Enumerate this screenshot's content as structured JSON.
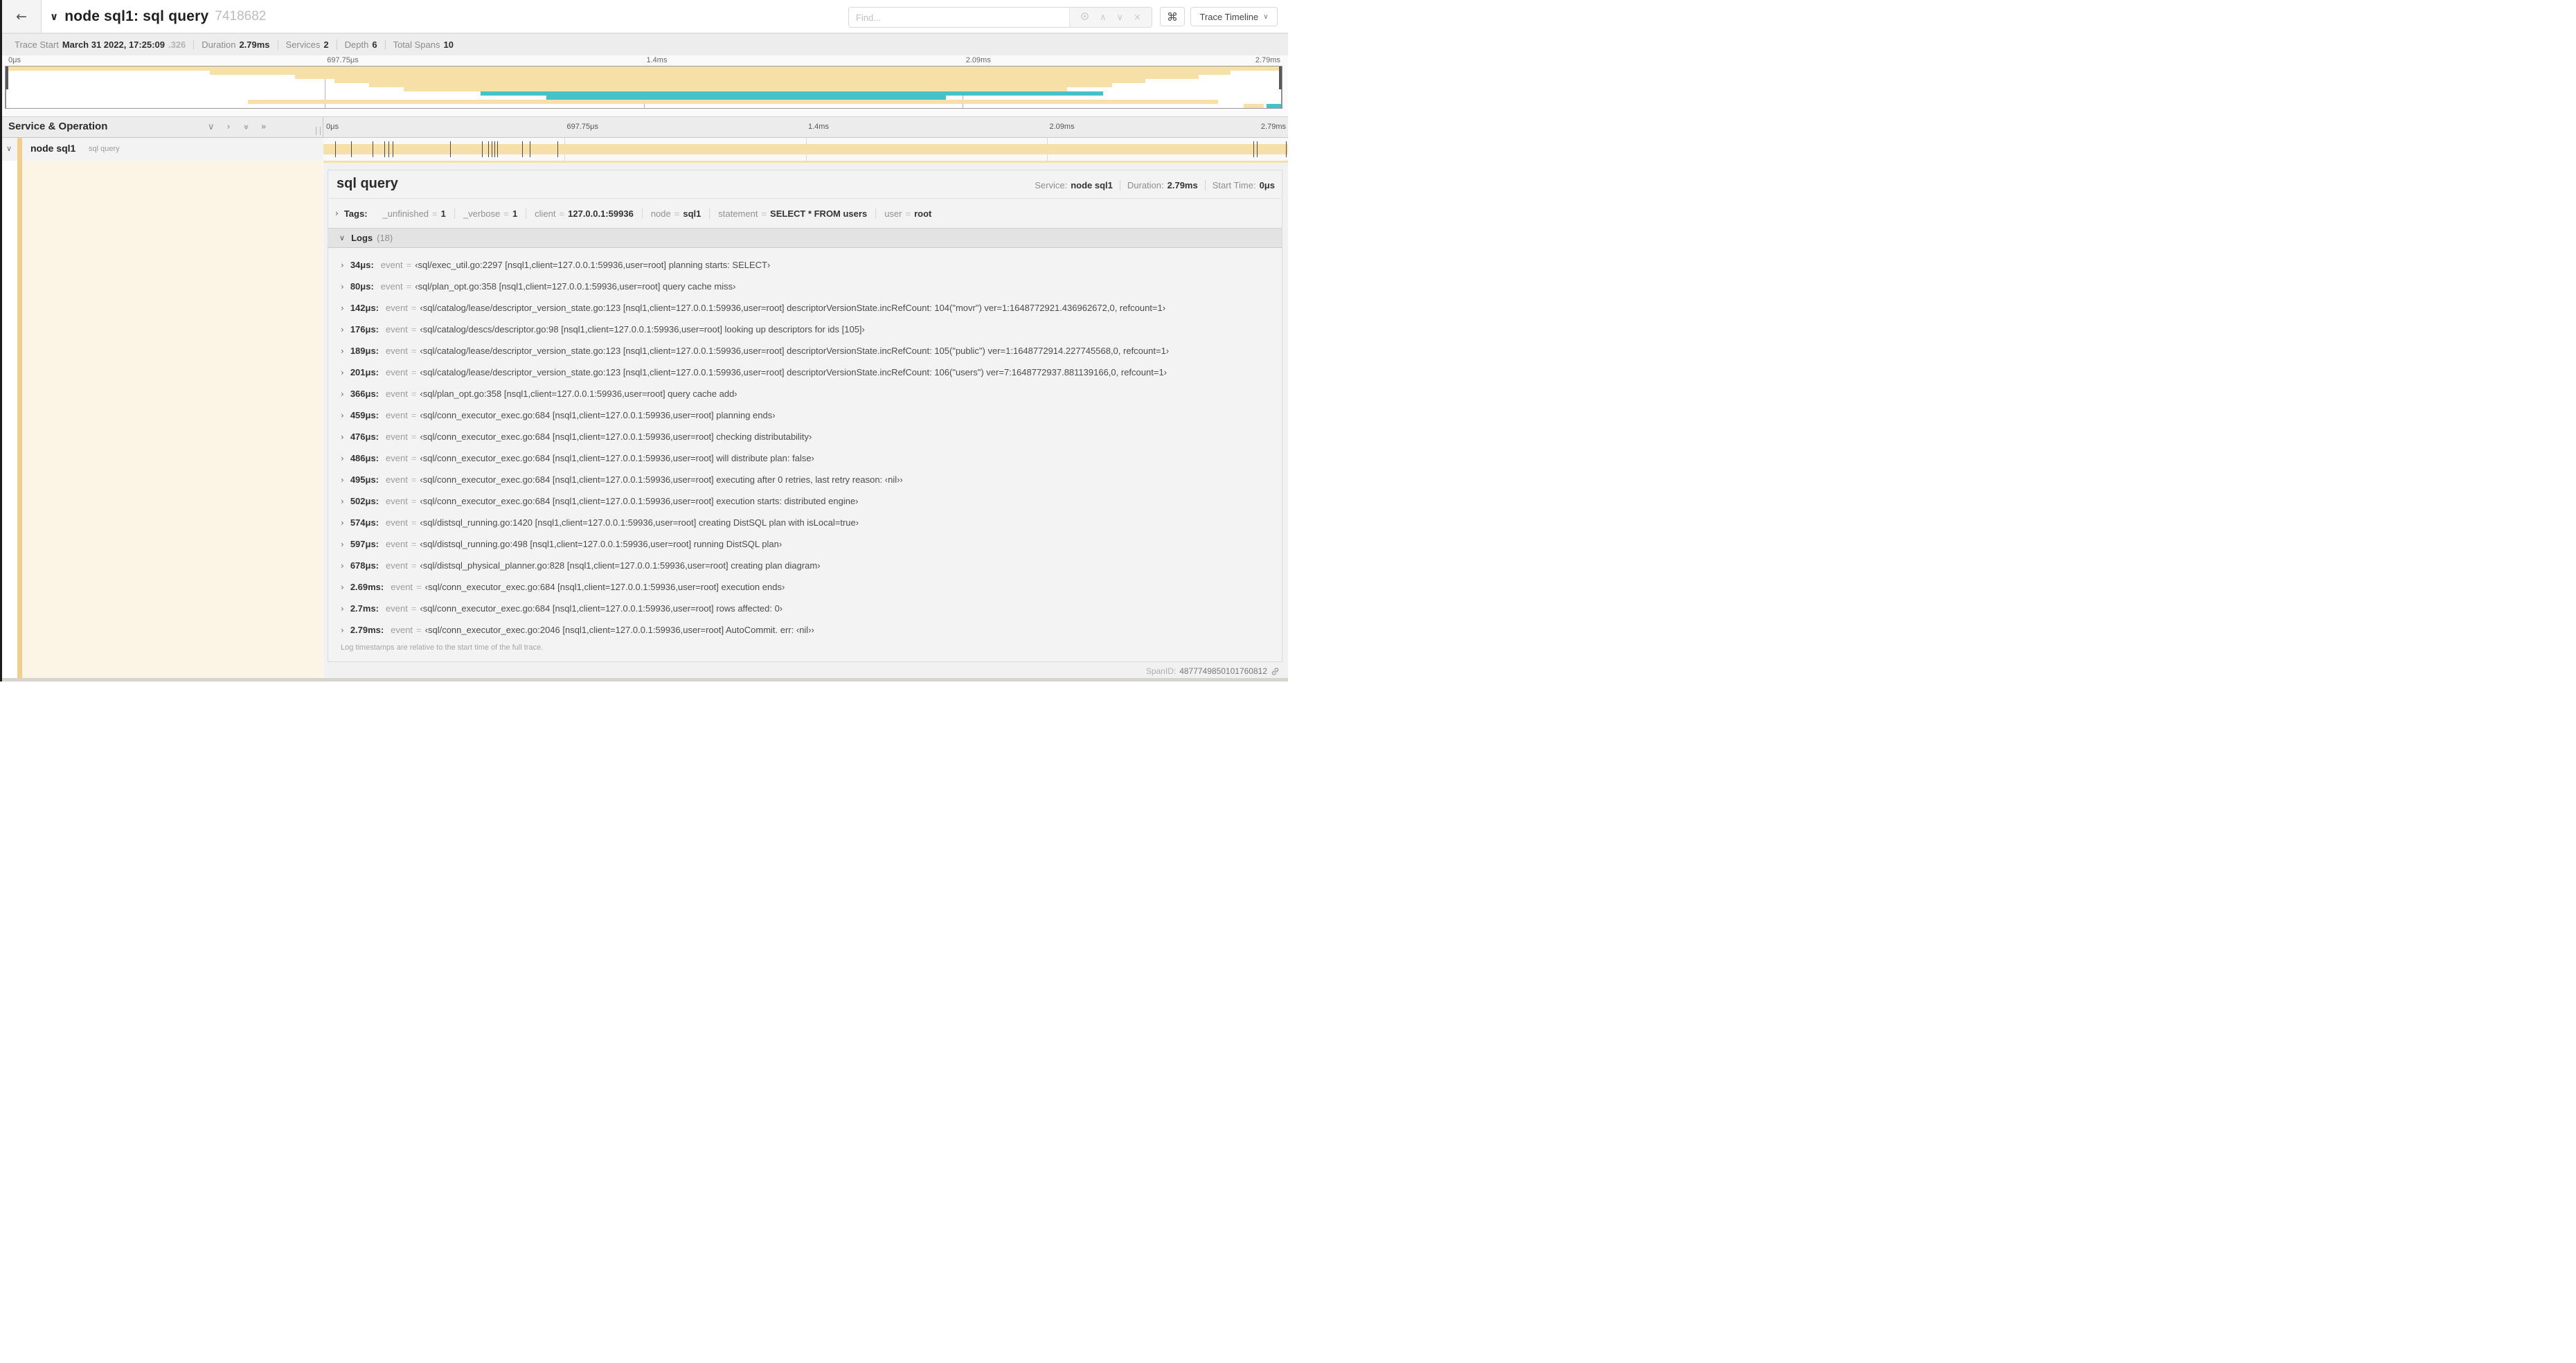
{
  "header": {
    "back_icon": "←",
    "collapse_caret": "∨",
    "title": "node sql1: sql query",
    "trace_id": "7418682",
    "find_placeholder": "Find...",
    "prev_icon": "∧",
    "next_icon": "∨",
    "clear_icon": "×",
    "shortcut_icon": "⌘",
    "view_selector": "Trace Timeline",
    "view_caret": "∨"
  },
  "summary": {
    "items": [
      {
        "label": "Trace Start",
        "value": "March 31 2022, 17:25:09",
        "suffix": ".326"
      },
      {
        "label": "Duration",
        "value": "2.79ms",
        "suffix": ""
      },
      {
        "label": "Services",
        "value": "2",
        "suffix": ""
      },
      {
        "label": "Depth",
        "value": "6",
        "suffix": ""
      },
      {
        "label": "Total Spans",
        "value": "10",
        "suffix": ""
      }
    ]
  },
  "colors": {
    "tan": "#f7dfa8",
    "teal": "#45c2c8",
    "accent_strip": "#f0cf8d",
    "cream": "#fcf5e6"
  },
  "minimap": {
    "ticks": [
      "0μs",
      "697.75μs",
      "1.4ms",
      "2.09ms",
      "2.79ms"
    ],
    "bars": [
      {
        "row": 0,
        "start": 0,
        "end": 100,
        "color": "tan"
      },
      {
        "row": 1,
        "start": 16,
        "end": 96,
        "color": "tan"
      },
      {
        "row": 2,
        "start": 22.7,
        "end": 93.5,
        "color": "tan"
      },
      {
        "row": 3,
        "start": 25.8,
        "end": 89.3,
        "color": "tan"
      },
      {
        "row": 4,
        "start": 28.5,
        "end": 86.7,
        "color": "tan"
      },
      {
        "row": 5,
        "start": 31.2,
        "end": 83.2,
        "color": "tan"
      },
      {
        "row": 6,
        "start": 37.2,
        "end": 86.0,
        "color": "teal"
      },
      {
        "row": 7,
        "start": 42.4,
        "end": 73.7,
        "color": "teal"
      },
      {
        "row": 8,
        "start": 19.0,
        "end": 95.0,
        "color": "tan"
      },
      {
        "row": 9,
        "start": 97.0,
        "end": 98.6,
        "color": "tan"
      },
      {
        "row": 9,
        "start": 98.8,
        "end": 100,
        "color": "teal"
      }
    ]
  },
  "timeline": {
    "left_header": "Service & Operation",
    "ticks": [
      "0μs",
      "697.75μs",
      "1.4ms",
      "2.09ms",
      "2.79ms"
    ],
    "row": {
      "service": "node sql1",
      "operation": "sql query"
    },
    "log_marker_positions": [
      1.22,
      2.87,
      5.09,
      6.31,
      6.77,
      7.2,
      13.12,
      16.45,
      17.06,
      17.42,
      17.74,
      17.99,
      20.57,
      21.4,
      24.3,
      96.42,
      96.77,
      99.8
    ]
  },
  "detail": {
    "operation": "sql query",
    "meta": [
      {
        "label": "Service:",
        "value": "node sql1"
      },
      {
        "label": "Duration:",
        "value": "2.79ms"
      },
      {
        "label": "Start Time:",
        "value": "0μs"
      }
    ],
    "tags_label": "Tags:",
    "tags": [
      {
        "key": "_unfinished",
        "value": "1"
      },
      {
        "key": "_verbose",
        "value": "1"
      },
      {
        "key": "client",
        "value": "127.0.0.1:59936"
      },
      {
        "key": "node",
        "value": "sql1"
      },
      {
        "key": "statement",
        "value": "SELECT * FROM users"
      },
      {
        "key": "user",
        "value": "root"
      }
    ],
    "logs_label": "Logs",
    "logs_count": "(18)",
    "log_field_key": "event",
    "logs": [
      {
        "time": "34μs:",
        "value": "‹sql/exec_util.go:2297 [nsql1,client=127.0.0.1:59936,user=root] planning starts: SELECT›"
      },
      {
        "time": "80μs:",
        "value": "‹sql/plan_opt.go:358 [nsql1,client=127.0.0.1:59936,user=root] query cache miss›"
      },
      {
        "time": "142μs:",
        "value": "‹sql/catalog/lease/descriptor_version_state.go:123 [nsql1,client=127.0.0.1:59936,user=root] descriptorVersionState.incRefCount: 104(\"movr\") ver=1:1648772921.436962672,0, refcount=1›"
      },
      {
        "time": "176μs:",
        "value": "‹sql/catalog/descs/descriptor.go:98 [nsql1,client=127.0.0.1:59936,user=root] looking up descriptors for ids [105]›"
      },
      {
        "time": "189μs:",
        "value": "‹sql/catalog/lease/descriptor_version_state.go:123 [nsql1,client=127.0.0.1:59936,user=root] descriptorVersionState.incRefCount: 105(\"public\") ver=1:1648772914.227745568,0, refcount=1›"
      },
      {
        "time": "201μs:",
        "value": "‹sql/catalog/lease/descriptor_version_state.go:123 [nsql1,client=127.0.0.1:59936,user=root] descriptorVersionState.incRefCount: 106(\"users\") ver=7:1648772937.881139166,0, refcount=1›"
      },
      {
        "time": "366μs:",
        "value": "‹sql/plan_opt.go:358 [nsql1,client=127.0.0.1:59936,user=root] query cache add›"
      },
      {
        "time": "459μs:",
        "value": "‹sql/conn_executor_exec.go:684 [nsql1,client=127.0.0.1:59936,user=root] planning ends›"
      },
      {
        "time": "476μs:",
        "value": "‹sql/conn_executor_exec.go:684 [nsql1,client=127.0.0.1:59936,user=root] checking distributability›"
      },
      {
        "time": "486μs:",
        "value": "‹sql/conn_executor_exec.go:684 [nsql1,client=127.0.0.1:59936,user=root] will distribute plan: false›"
      },
      {
        "time": "495μs:",
        "value": "‹sql/conn_executor_exec.go:684 [nsql1,client=127.0.0.1:59936,user=root] executing after 0 retries, last retry reason: ‹nil››"
      },
      {
        "time": "502μs:",
        "value": "‹sql/conn_executor_exec.go:684 [nsql1,client=127.0.0.1:59936,user=root] execution starts: distributed engine›"
      },
      {
        "time": "574μs:",
        "value": "‹sql/distsql_running.go:1420 [nsql1,client=127.0.0.1:59936,user=root] creating DistSQL plan with isLocal=true›"
      },
      {
        "time": "597μs:",
        "value": "‹sql/distsql_running.go:498 [nsql1,client=127.0.0.1:59936,user=root] running DistSQL plan›"
      },
      {
        "time": "678μs:",
        "value": "‹sql/distsql_physical_planner.go:828 [nsql1,client=127.0.0.1:59936,user=root] creating plan diagram›"
      },
      {
        "time": "2.69ms:",
        "value": "‹sql/conn_executor_exec.go:684 [nsql1,client=127.0.0.1:59936,user=root] execution ends›"
      },
      {
        "time": "2.7ms:",
        "value": "‹sql/conn_executor_exec.go:684 [nsql1,client=127.0.0.1:59936,user=root] rows affected: 0›"
      },
      {
        "time": "2.79ms:",
        "value": "‹sql/conn_executor_exec.go:2046 [nsql1,client=127.0.0.1:59936,user=root] AutoCommit. err: ‹nil››"
      }
    ],
    "footnote": "Log timestamps are relative to the start time of the full trace.",
    "span_id_label": "SpanID:",
    "span_id": "4877749850101760812"
  }
}
